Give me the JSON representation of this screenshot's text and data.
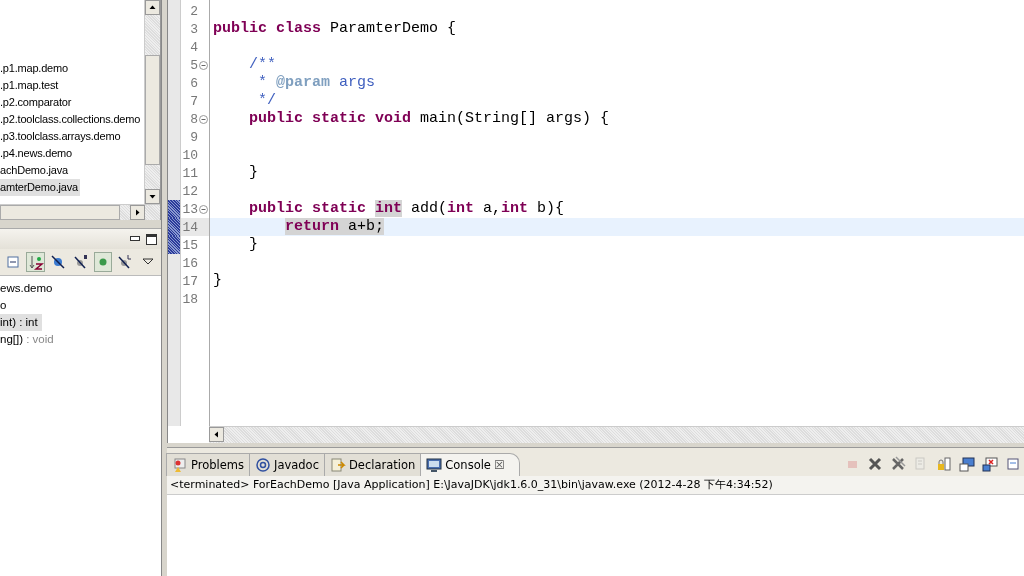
{
  "package_explorer": {
    "items": [
      {
        "label": ".p1.map.demo",
        "selected": false
      },
      {
        "label": ".p1.map.test",
        "selected": false
      },
      {
        "label": ".p2.comparator",
        "selected": false
      },
      {
        "label": ".p2.toolclass.collections.demo",
        "selected": false
      },
      {
        "label": ".p3.toolclass.arrays.demo",
        "selected": false
      },
      {
        "label": ".p4.news.demo",
        "selected": false
      },
      {
        "label": "achDemo.java",
        "selected": false
      },
      {
        "label": "amterDemo.java",
        "selected": true
      }
    ]
  },
  "outline": {
    "toolbar": [
      {
        "kind": "collapse",
        "pressed": false
      },
      {
        "kind": "sort",
        "pressed": true
      },
      {
        "kind": "hide-fields",
        "pressed": false
      },
      {
        "kind": "hide-static",
        "pressed": false
      },
      {
        "kind": "hide-non-public",
        "pressed": true
      },
      {
        "kind": "hide-local",
        "pressed": false
      },
      {
        "kind": "menu",
        "pressed": false
      }
    ],
    "items": [
      {
        "label": "ews.demo",
        "selected": false
      },
      {
        "label": "o",
        "selected": false
      },
      {
        "label": "int) : int",
        "selected": true
      },
      {
        "label": "ng[])",
        "suffix": ": void",
        "selected": false
      }
    ]
  },
  "editor": {
    "lines": [
      {
        "number": "2",
        "foldable": false,
        "in_range": false,
        "current": false
      },
      {
        "number": "3",
        "foldable": false,
        "in_range": false,
        "current": false,
        "tokens": [
          {
            "text": "public",
            "kind": "keyword",
            "marked": false
          },
          {
            "text": " class",
            "kind": "keyword",
            "marked": false
          },
          {
            "text": " ParamterDemo {",
            "kind": "plain",
            "marked": false
          }
        ]
      },
      {
        "number": "4",
        "foldable": false,
        "in_range": false,
        "current": false
      },
      {
        "number": "5",
        "foldable": true,
        "in_range": false,
        "current": false,
        "tokens": [
          {
            "text": "    /**",
            "kind": "comment",
            "marked": false
          }
        ]
      },
      {
        "number": "6",
        "foldable": false,
        "in_range": false,
        "current": false,
        "tokens": [
          {
            "text": "     * ",
            "kind": "comment",
            "marked": false
          },
          {
            "text": "@param",
            "kind": "doctag",
            "marked": false
          },
          {
            "text": " args",
            "kind": "comment",
            "marked": false
          }
        ]
      },
      {
        "number": "7",
        "foldable": false,
        "in_range": false,
        "current": false,
        "tokens": [
          {
            "text": "     */",
            "kind": "comment",
            "marked": false
          }
        ]
      },
      {
        "number": "8",
        "foldable": true,
        "in_range": false,
        "current": false,
        "tokens": [
          {
            "text": "    public",
            "kind": "keyword",
            "marked": false
          },
          {
            "text": " static",
            "kind": "keyword",
            "marked": false
          },
          {
            "text": " void",
            "kind": "keyword",
            "marked": false
          },
          {
            "text": " main(String[] args) {",
            "kind": "plain",
            "marked": false
          }
        ]
      },
      {
        "number": "9",
        "foldable": false,
        "in_range": false,
        "current": false
      },
      {
        "number": "10",
        "foldable": false,
        "in_range": false,
        "current": false
      },
      {
        "number": "11",
        "foldable": false,
        "in_range": false,
        "current": false,
        "tokens": [
          {
            "text": "    }",
            "kind": "plain",
            "marked": false
          }
        ]
      },
      {
        "number": "12",
        "foldable": false,
        "in_range": false,
        "current": false
      },
      {
        "number": "13",
        "foldable": true,
        "in_range": true,
        "current": false,
        "tokens": [
          {
            "text": "    public",
            "kind": "keyword",
            "marked": false
          },
          {
            "text": " static ",
            "kind": "keyword",
            "marked": false
          },
          {
            "text": "int",
            "kind": "keyword",
            "marked": true
          },
          {
            "text": " add(",
            "kind": "plain",
            "marked": false
          },
          {
            "text": "int",
            "kind": "keyword",
            "marked": false
          },
          {
            "text": " a,",
            "kind": "plain",
            "marked": false
          },
          {
            "text": "int",
            "kind": "keyword",
            "marked": false
          },
          {
            "text": " b){",
            "kind": "plain",
            "marked": false
          }
        ]
      },
      {
        "number": "14",
        "foldable": false,
        "in_range": true,
        "current": true,
        "indented": true,
        "tokens": [
          {
            "text": "return",
            "kind": "keyword",
            "marked": true
          },
          {
            "text": " a+b;",
            "kind": "plain",
            "marked": true
          }
        ]
      },
      {
        "number": "15",
        "foldable": false,
        "in_range": true,
        "current": false,
        "tokens": [
          {
            "text": "    }",
            "kind": "plain",
            "marked": false
          }
        ]
      },
      {
        "number": "16",
        "foldable": false,
        "in_range": false,
        "current": false
      },
      {
        "number": "17",
        "foldable": false,
        "in_range": false,
        "current": false,
        "tokens": [
          {
            "text": "}",
            "kind": "plain",
            "marked": false
          }
        ]
      },
      {
        "number": "18",
        "foldable": false,
        "in_range": false,
        "current": false
      }
    ]
  },
  "bottom_panel": {
    "tabs": [
      {
        "label": "Problems",
        "kind": "problems",
        "selected": false
      },
      {
        "label": "Javadoc",
        "kind": "javadoc",
        "selected": false
      },
      {
        "label": "Declaration",
        "kind": "declaration",
        "selected": false
      },
      {
        "label": "Console",
        "kind": "console",
        "selected": true,
        "close": "☒"
      }
    ],
    "toolbar": [
      {
        "kind": "terminate",
        "disabled": true
      },
      {
        "kind": "remove",
        "disabled": false
      },
      {
        "kind": "remove-all",
        "disabled": false
      },
      {
        "kind": "clear",
        "disabled": true
      },
      {
        "kind": "scroll-lock",
        "disabled": false
      },
      {
        "kind": "show-on-output",
        "disabled": false
      },
      {
        "kind": "show-on-error",
        "disabled": false
      },
      {
        "kind": "pin",
        "disabled": false
      }
    ],
    "console_header": "<terminated> ForEachDemo [Java Application] E:\\JavaJDK\\jdk1.6.0_31\\bin\\javaw.exe (2012-4-28 下午4:34:52)"
  }
}
